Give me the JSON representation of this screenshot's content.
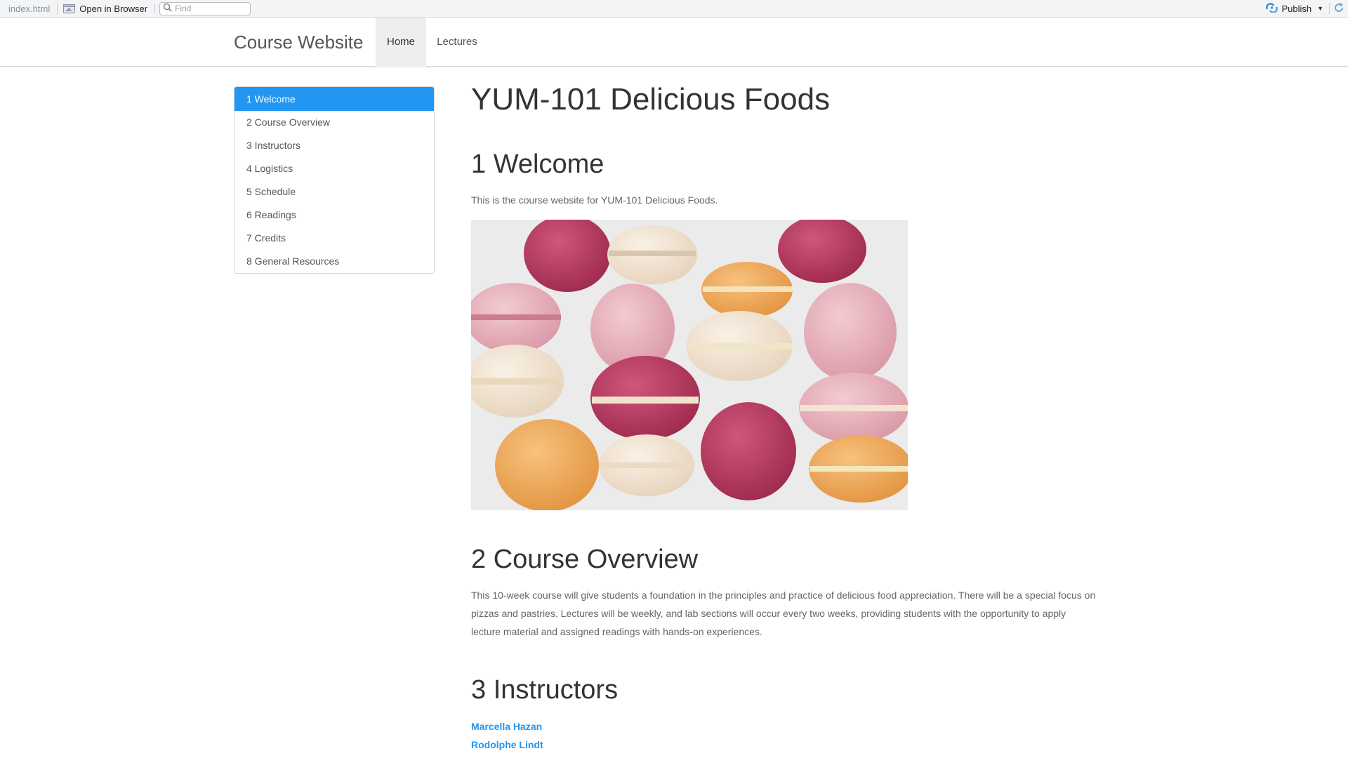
{
  "viewer": {
    "filename": "index.html",
    "open_in_browser": "Open in Browser",
    "find_placeholder": "Find",
    "publish": "Publish",
    "icons": [
      "browser-icon",
      "search-icon",
      "publish-icon",
      "chevron-down-icon",
      "refresh-icon"
    ]
  },
  "navbar": {
    "brand": "Course Website",
    "tabs": [
      {
        "label": "Home",
        "active": true
      },
      {
        "label": "Lectures",
        "active": false
      }
    ]
  },
  "toc": {
    "items": [
      {
        "label": "1 Welcome",
        "active": true
      },
      {
        "label": "2 Course Overview",
        "active": false
      },
      {
        "label": "3 Instructors",
        "active": false
      },
      {
        "label": "4 Logistics",
        "active": false
      },
      {
        "label": "5 Schedule",
        "active": false
      },
      {
        "label": "6 Readings",
        "active": false
      },
      {
        "label": "7 Credits",
        "active": false
      },
      {
        "label": "8 General Resources",
        "active": false
      }
    ],
    "active_color": "#2196f3"
  },
  "content": {
    "title": "YUM-101 Delicious Foods",
    "welcome": {
      "heading": "1 Welcome",
      "text": "This is the course website for YUM-101 Delicious Foods."
    },
    "overview": {
      "heading": "2 Course Overview",
      "text": "This 10-week course will give students a foundation in the principles and practice of delicious food appreciation. There will be a special focus on pizzas and pastries. Lectures will be weekly, and lab sections will occur every two weeks, providing students with the opportunity to apply lecture material and assigned readings with hands-on experiences."
    },
    "instructors": {
      "heading": "3 Instructors",
      "names": [
        "Marcella Hazan",
        "Rodolphe Lindt"
      ]
    },
    "link_color": "#2196f3"
  },
  "macaron_colors": {
    "magenta": "#b8365f",
    "pink": "#e8b4bf",
    "cream": "#f3e6d6",
    "orange": "#f2ac5c"
  }
}
